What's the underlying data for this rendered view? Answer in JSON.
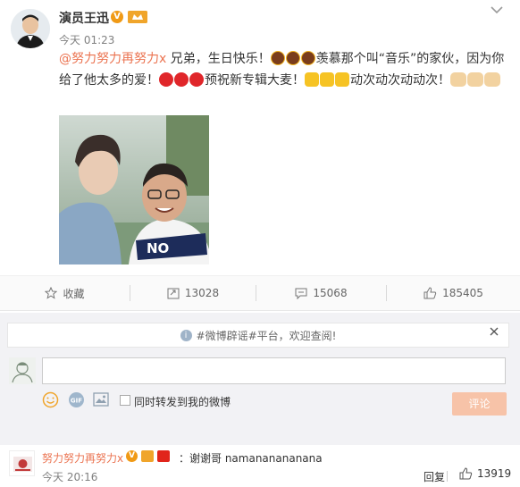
{
  "post": {
    "author": "演员王迅",
    "verified_mark": "V",
    "time": "今天 01:23",
    "mention": "@努力努力再努力x",
    "text_line1": " 兄弟，生日快乐！",
    "text_line1b": "羡慕那个叫“音乐”的家伙，因为你",
    "text_line2": "给了他太多的爱！",
    "text_line2b": "预祝新专辑大麦！",
    "text_line2c": "动次动次动动次！",
    "menu_icon": "chevron-down-icon",
    "photo_caption": "NO"
  },
  "actions": {
    "collect": "收藏",
    "repost": "13028",
    "comment": "15068",
    "like": "185405"
  },
  "comment_box": {
    "notice": "#微博辟谣#平台，欢迎查阅!",
    "input_value": "",
    "sync_label": "同时转发到我的微博",
    "submit": "评论",
    "gif_label": "GIF"
  },
  "comments": [
    {
      "user": "努力努力再努力x",
      "text": "：谢谢哥 namananananana",
      "time": "今天 20:16",
      "reply": "回复",
      "likes": "13919"
    }
  ],
  "colors": {
    "accent": "#eb7350",
    "verified": "#f09a16",
    "submit_bg": "#f7c3a8"
  }
}
